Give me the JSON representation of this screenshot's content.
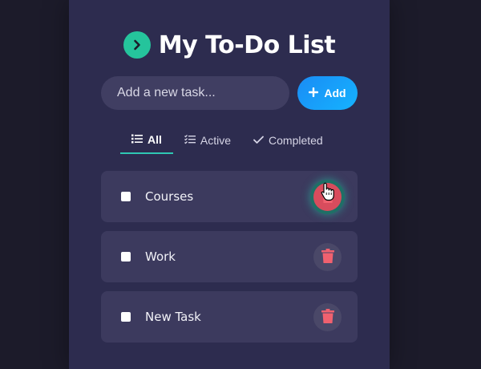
{
  "app": {
    "title": "My To-Do List",
    "title_icon": "chevron-right-icon",
    "accent_color": "#25c49c"
  },
  "new_task": {
    "placeholder": "Add a new task...",
    "value": "",
    "add_label": "Add",
    "add_icon": "plus-icon"
  },
  "tabs": [
    {
      "label": "All",
      "icon": "list-icon",
      "active": true
    },
    {
      "label": "Active",
      "icon": "tasks-icon",
      "active": false
    },
    {
      "label": "Completed",
      "icon": "check-icon",
      "active": false
    }
  ],
  "tasks": [
    {
      "label": "Courses",
      "checked": false,
      "delete_icon": "trash-icon"
    },
    {
      "label": "Work",
      "checked": false,
      "delete_icon": "trash-icon"
    },
    {
      "label": "New Task",
      "checked": false,
      "delete_icon": "trash-icon"
    }
  ],
  "colors": {
    "background": "#1c1b2a",
    "card": "#2d2c4f",
    "item": "#3c3a5e",
    "delete": "#f0616f",
    "add_button": "#1a8cf5"
  }
}
